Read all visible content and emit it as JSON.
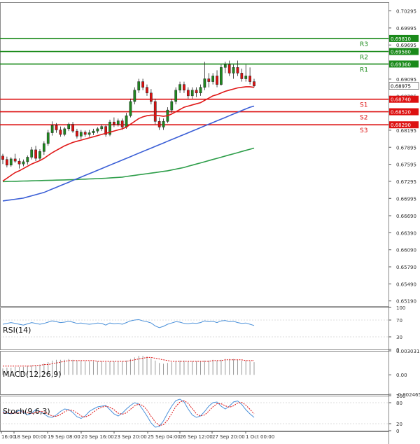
{
  "chart_data": {
    "type": "candlestick",
    "main": {
      "y_ticks": [
        "0.70295",
        "0.69995",
        "0.69695",
        "0.69095",
        "0.68795",
        "0.68195",
        "0.67895",
        "0.67595",
        "0.67295",
        "0.66995",
        "0.66690",
        "0.66390",
        "0.66090",
        "0.65790",
        "0.65490",
        "0.65190"
      ],
      "ylim": [
        0.651,
        0.7045
      ],
      "levels": [
        {
          "name": "R3",
          "value": 0.6981,
          "label": "0.69810",
          "color": "#1a8a1a"
        },
        {
          "name": "R2",
          "value": 0.6958,
          "label": "0.69580",
          "color": "#1a8a1a"
        },
        {
          "name": "R1",
          "value": 0.6936,
          "label": "0.69360",
          "color": "#1a8a1a"
        },
        {
          "name": "S1",
          "value": 0.6874,
          "label": "0.68740",
          "color": "#dd1111"
        },
        {
          "name": "S2",
          "value": 0.6852,
          "label": "0.68520",
          "color": "#dd1111"
        },
        {
          "name": "S3",
          "value": 0.6829,
          "label": "0.68290",
          "color": "#dd1111"
        }
      ],
      "current_price": {
        "value": 0.68975,
        "label": "0.68975"
      },
      "candles": [
        [
          0.6774,
          0.6778,
          0.676,
          0.6768
        ],
        [
          0.6768,
          0.6773,
          0.6754,
          0.6758
        ],
        [
          0.6758,
          0.6772,
          0.6755,
          0.6769
        ],
        [
          0.6769,
          0.6778,
          0.6762,
          0.6765
        ],
        [
          0.6765,
          0.677,
          0.6752,
          0.676
        ],
        [
          0.676,
          0.6768,
          0.6756,
          0.6764
        ],
        [
          0.6764,
          0.6775,
          0.6759,
          0.6772
        ],
        [
          0.6772,
          0.679,
          0.6768,
          0.6785
        ],
        [
          0.6785,
          0.6792,
          0.6765,
          0.677
        ],
        [
          0.677,
          0.6786,
          0.6766,
          0.6782
        ],
        [
          0.6782,
          0.68,
          0.6776,
          0.6796
        ],
        [
          0.6796,
          0.682,
          0.6792,
          0.6815
        ],
        [
          0.6815,
          0.6835,
          0.681,
          0.6828
        ],
        [
          0.6828,
          0.6832,
          0.6815,
          0.682
        ],
        [
          0.682,
          0.6826,
          0.6808,
          0.6812
        ],
        [
          0.6812,
          0.6825,
          0.6809,
          0.6822
        ],
        [
          0.6822,
          0.6833,
          0.6818,
          0.683
        ],
        [
          0.683,
          0.6834,
          0.6815,
          0.6818
        ],
        [
          0.6818,
          0.6822,
          0.6805,
          0.6809
        ],
        [
          0.6809,
          0.682,
          0.6804,
          0.6816
        ],
        [
          0.6816,
          0.6819,
          0.6808,
          0.6812
        ],
        [
          0.6812,
          0.682,
          0.6808,
          0.6815
        ],
        [
          0.6815,
          0.6822,
          0.6811,
          0.6818
        ],
        [
          0.6818,
          0.6825,
          0.6814,
          0.6822
        ],
        [
          0.6822,
          0.683,
          0.6818,
          0.6826
        ],
        [
          0.6826,
          0.6829,
          0.6808,
          0.6812
        ],
        [
          0.6812,
          0.6838,
          0.6809,
          0.6834
        ],
        [
          0.6834,
          0.6842,
          0.6825,
          0.683
        ],
        [
          0.683,
          0.684,
          0.6826,
          0.6836
        ],
        [
          0.6836,
          0.684,
          0.682,
          0.6825
        ],
        [
          0.6825,
          0.685,
          0.6822,
          0.6845
        ],
        [
          0.6845,
          0.6875,
          0.6842,
          0.687
        ],
        [
          0.687,
          0.6895,
          0.6865,
          0.689
        ],
        [
          0.689,
          0.691,
          0.6885,
          0.6905
        ],
        [
          0.6905,
          0.691,
          0.689,
          0.6895
        ],
        [
          0.6895,
          0.69,
          0.688,
          0.6885
        ],
        [
          0.6885,
          0.6892,
          0.6865,
          0.687
        ],
        [
          0.687,
          0.6875,
          0.683,
          0.6835
        ],
        [
          0.6835,
          0.6842,
          0.682,
          0.6825
        ],
        [
          0.6825,
          0.684,
          0.682,
          0.6835
        ],
        [
          0.6835,
          0.686,
          0.6832,
          0.6855
        ],
        [
          0.6855,
          0.6875,
          0.685,
          0.687
        ],
        [
          0.687,
          0.6895,
          0.6865,
          0.689
        ],
        [
          0.689,
          0.6905,
          0.6885,
          0.69
        ],
        [
          0.69,
          0.6905,
          0.6885,
          0.689
        ],
        [
          0.689,
          0.6895,
          0.6875,
          0.688
        ],
        [
          0.688,
          0.6895,
          0.6875,
          0.689
        ],
        [
          0.689,
          0.6895,
          0.6878,
          0.6885
        ],
        [
          0.6885,
          0.69,
          0.688,
          0.6895
        ],
        [
          0.6895,
          0.694,
          0.689,
          0.691
        ],
        [
          0.691,
          0.692,
          0.6895,
          0.6905
        ],
        [
          0.6905,
          0.692,
          0.69,
          0.6915
        ],
        [
          0.6915,
          0.6925,
          0.6895,
          0.69
        ],
        [
          0.69,
          0.6935,
          0.6898,
          0.693
        ],
        [
          0.693,
          0.694,
          0.692,
          0.6935
        ],
        [
          0.6935,
          0.6942,
          0.6915,
          0.692
        ],
        [
          0.692,
          0.6935,
          0.691,
          0.693
        ],
        [
          0.693,
          0.6942,
          0.6915,
          0.692
        ],
        [
          0.692,
          0.6928,
          0.6905,
          0.691
        ],
        [
          0.691,
          0.6935,
          0.6905,
          0.6915
        ],
        [
          0.6915,
          0.693,
          0.69,
          0.6905
        ],
        [
          0.6905,
          0.691,
          0.6895,
          0.68975
        ]
      ],
      "ma_fast": [
        0.673,
        0.6735,
        0.674,
        0.6745,
        0.6748,
        0.6752,
        0.6756,
        0.676,
        0.6763,
        0.6766,
        0.677,
        0.6775,
        0.678,
        0.6784,
        0.6788,
        0.6792,
        0.6795,
        0.6798,
        0.68,
        0.6802,
        0.6804,
        0.6806,
        0.6808,
        0.681,
        0.6812,
        0.6814,
        0.6816,
        0.6818,
        0.682,
        0.6822,
        0.6825,
        0.683,
        0.6835,
        0.684,
        0.6843,
        0.6845,
        0.6846,
        0.6846,
        0.6845,
        0.6844,
        0.6845,
        0.6848,
        0.6852,
        0.6856,
        0.686,
        0.6862,
        0.6864,
        0.6866,
        0.6868,
        0.6872,
        0.6876,
        0.688,
        0.6882,
        0.6885,
        0.6888,
        0.689,
        0.6892,
        0.6894,
        0.6895,
        0.6896,
        0.6896,
        0.6895
      ],
      "ma_mid": [
        0.6695,
        0.6696,
        0.6697,
        0.6698,
        0.6699,
        0.67,
        0.6702,
        0.6704,
        0.6706,
        0.6708,
        0.671,
        0.6713,
        0.6716,
        0.6719,
        0.6722,
        0.6725,
        0.6728,
        0.6731,
        0.6734,
        0.6737,
        0.674,
        0.6743,
        0.6746,
        0.6749,
        0.6752,
        0.6755,
        0.6758,
        0.6761,
        0.6764,
        0.6767,
        0.677,
        0.6773,
        0.6776,
        0.6779,
        0.6782,
        0.6785,
        0.6788,
        0.6791,
        0.6794,
        0.6797,
        0.68,
        0.6803,
        0.6806,
        0.6809,
        0.6812,
        0.6815,
        0.6818,
        0.6821,
        0.6824,
        0.6827,
        0.683,
        0.6833,
        0.6836,
        0.6839,
        0.6842,
        0.6845,
        0.6848,
        0.6851,
        0.6854,
        0.6857,
        0.686,
        0.6862
      ],
      "ma_slow": [
        0.6729,
        0.67292,
        0.67294,
        0.67296,
        0.67298,
        0.673,
        0.67302,
        0.67304,
        0.67306,
        0.67308,
        0.6731,
        0.67312,
        0.67314,
        0.67316,
        0.67318,
        0.6732,
        0.67322,
        0.67325,
        0.67328,
        0.67331,
        0.67334,
        0.67337,
        0.6734,
        0.67343,
        0.67346,
        0.6735,
        0.67355,
        0.6736,
        0.67365,
        0.6737,
        0.6738,
        0.6739,
        0.674,
        0.6741,
        0.6742,
        0.6743,
        0.6744,
        0.6745,
        0.6746,
        0.6747,
        0.6748,
        0.67495,
        0.6751,
        0.67525,
        0.6754,
        0.6756,
        0.6758,
        0.676,
        0.6762,
        0.6764,
        0.6766,
        0.6768,
        0.677,
        0.6772,
        0.6774,
        0.6776,
        0.6778,
        0.678,
        0.6782,
        0.6784,
        0.6786,
        0.6788
      ]
    },
    "rsi": {
      "label": "RSI(14)",
      "y_ticks": [
        "100",
        "70",
        "30",
        "0"
      ],
      "ylim": [
        0,
        100
      ],
      "values": [
        60,
        62,
        64,
        62,
        60,
        58,
        61,
        64,
        62,
        60,
        62,
        65,
        68,
        66,
        64,
        65,
        67,
        65,
        62,
        63,
        61,
        60,
        61,
        63,
        62,
        58,
        63,
        61,
        62,
        60,
        64,
        68,
        70,
        71,
        68,
        66,
        63,
        56,
        52,
        55,
        60,
        63,
        66,
        65,
        62,
        61,
        63,
        62,
        64,
        68,
        66,
        67,
        64,
        68,
        69,
        66,
        67,
        64,
        62,
        63,
        60,
        57
      ]
    },
    "macd": {
      "label": "MACD(12,26,9)",
      "y_ticks": [
        "0.003031",
        "0.00",
        "-0.002465"
      ],
      "ylim": [
        -0.002465,
        0.003031
      ],
      "hist": [
        0.0008,
        0.0009,
        0.0009,
        0.001,
        0.001,
        0.001,
        0.0011,
        0.0012,
        0.0012,
        0.0013,
        0.0014,
        0.0016,
        0.0018,
        0.0019,
        0.0019,
        0.0019,
        0.002,
        0.0019,
        0.0018,
        0.0018,
        0.0017,
        0.0017,
        0.0017,
        0.0017,
        0.0017,
        0.0016,
        0.0017,
        0.0017,
        0.0017,
        0.0017,
        0.0018,
        0.002,
        0.0022,
        0.0024,
        0.0024,
        0.0023,
        0.0021,
        0.0018,
        0.0015,
        0.0014,
        0.0015,
        0.0016,
        0.0017,
        0.0018,
        0.0018,
        0.0017,
        0.0017,
        0.0017,
        0.0017,
        0.0018,
        0.0018,
        0.0019,
        0.0018,
        0.0019,
        0.002,
        0.002,
        0.002,
        0.0019,
        0.0018,
        0.0018,
        0.0017,
        0.0016
      ],
      "signal": [
        0.0011,
        0.0011,
        0.0011,
        0.0011,
        0.0011,
        0.0011,
        0.0011,
        0.0011,
        0.0012,
        0.0012,
        0.0013,
        0.0013,
        0.0014,
        0.0015,
        0.0016,
        0.0017,
        0.0018,
        0.0018,
        0.0018,
        0.0018,
        0.0018,
        0.0018,
        0.0018,
        0.0017,
        0.0017,
        0.0017,
        0.0017,
        0.0017,
        0.0017,
        0.0017,
        0.0017,
        0.0018,
        0.0019,
        0.002,
        0.0021,
        0.0022,
        0.0022,
        0.0021,
        0.002,
        0.0019,
        0.0018,
        0.0017,
        0.0017,
        0.0017,
        0.0017,
        0.0017,
        0.0017,
        0.0017,
        0.0017,
        0.0017,
        0.0017,
        0.0018,
        0.0018,
        0.0018,
        0.0019,
        0.0019,
        0.0019,
        0.0019,
        0.0019,
        0.0018,
        0.0018,
        0.0018
      ]
    },
    "stoch": {
      "label": "Stoch(9,6,3)",
      "y_ticks": [
        "100",
        "80",
        "20",
        "0"
      ],
      "ylim": [
        0,
        100
      ],
      "k": [
        55,
        50,
        48,
        52,
        58,
        52,
        45,
        50,
        60,
        55,
        48,
        40,
        38,
        45,
        55,
        62,
        60,
        52,
        40,
        35,
        42,
        55,
        62,
        68,
        70,
        72,
        60,
        48,
        42,
        50,
        62,
        72,
        80,
        76,
        60,
        42,
        22,
        10,
        12,
        28,
        50,
        70,
        86,
        90,
        82,
        62,
        45,
        38,
        42,
        55,
        70,
        80,
        82,
        70,
        62,
        70,
        82,
        85,
        75,
        60,
        48,
        38
      ],
      "d": [
        52,
        52,
        50,
        50,
        53,
        54,
        52,
        49,
        52,
        55,
        54,
        48,
        42,
        41,
        46,
        54,
        59,
        58,
        51,
        42,
        39,
        44,
        53,
        62,
        67,
        70,
        67,
        60,
        50,
        47,
        51,
        61,
        71,
        76,
        72,
        59,
        41,
        25,
        15,
        17,
        30,
        49,
        69,
        82,
        86,
        78,
        63,
        48,
        42,
        45,
        56,
        68,
        77,
        77,
        71,
        67,
        71,
        79,
        81,
        73,
        61,
        48
      ]
    },
    "x_labels": [
      "16:00",
      "18 Sep 00:00",
      "19 Sep 08:00",
      "20 Sep 16:00",
      "23 Sep 20:00",
      "25 Sep 04:00",
      "26 Sep 12:00",
      "27 Sep 20:00",
      "1 Oct 00:00"
    ],
    "colors": {
      "bull": "#1f8a1f",
      "bear": "#dd1111",
      "ma_fast": "#e01818",
      "ma_mid": "#3b5fd6",
      "ma_slow": "#2e9e4a",
      "indicator_line": "#4a90d9",
      "signal_line": "#dd1111"
    }
  }
}
